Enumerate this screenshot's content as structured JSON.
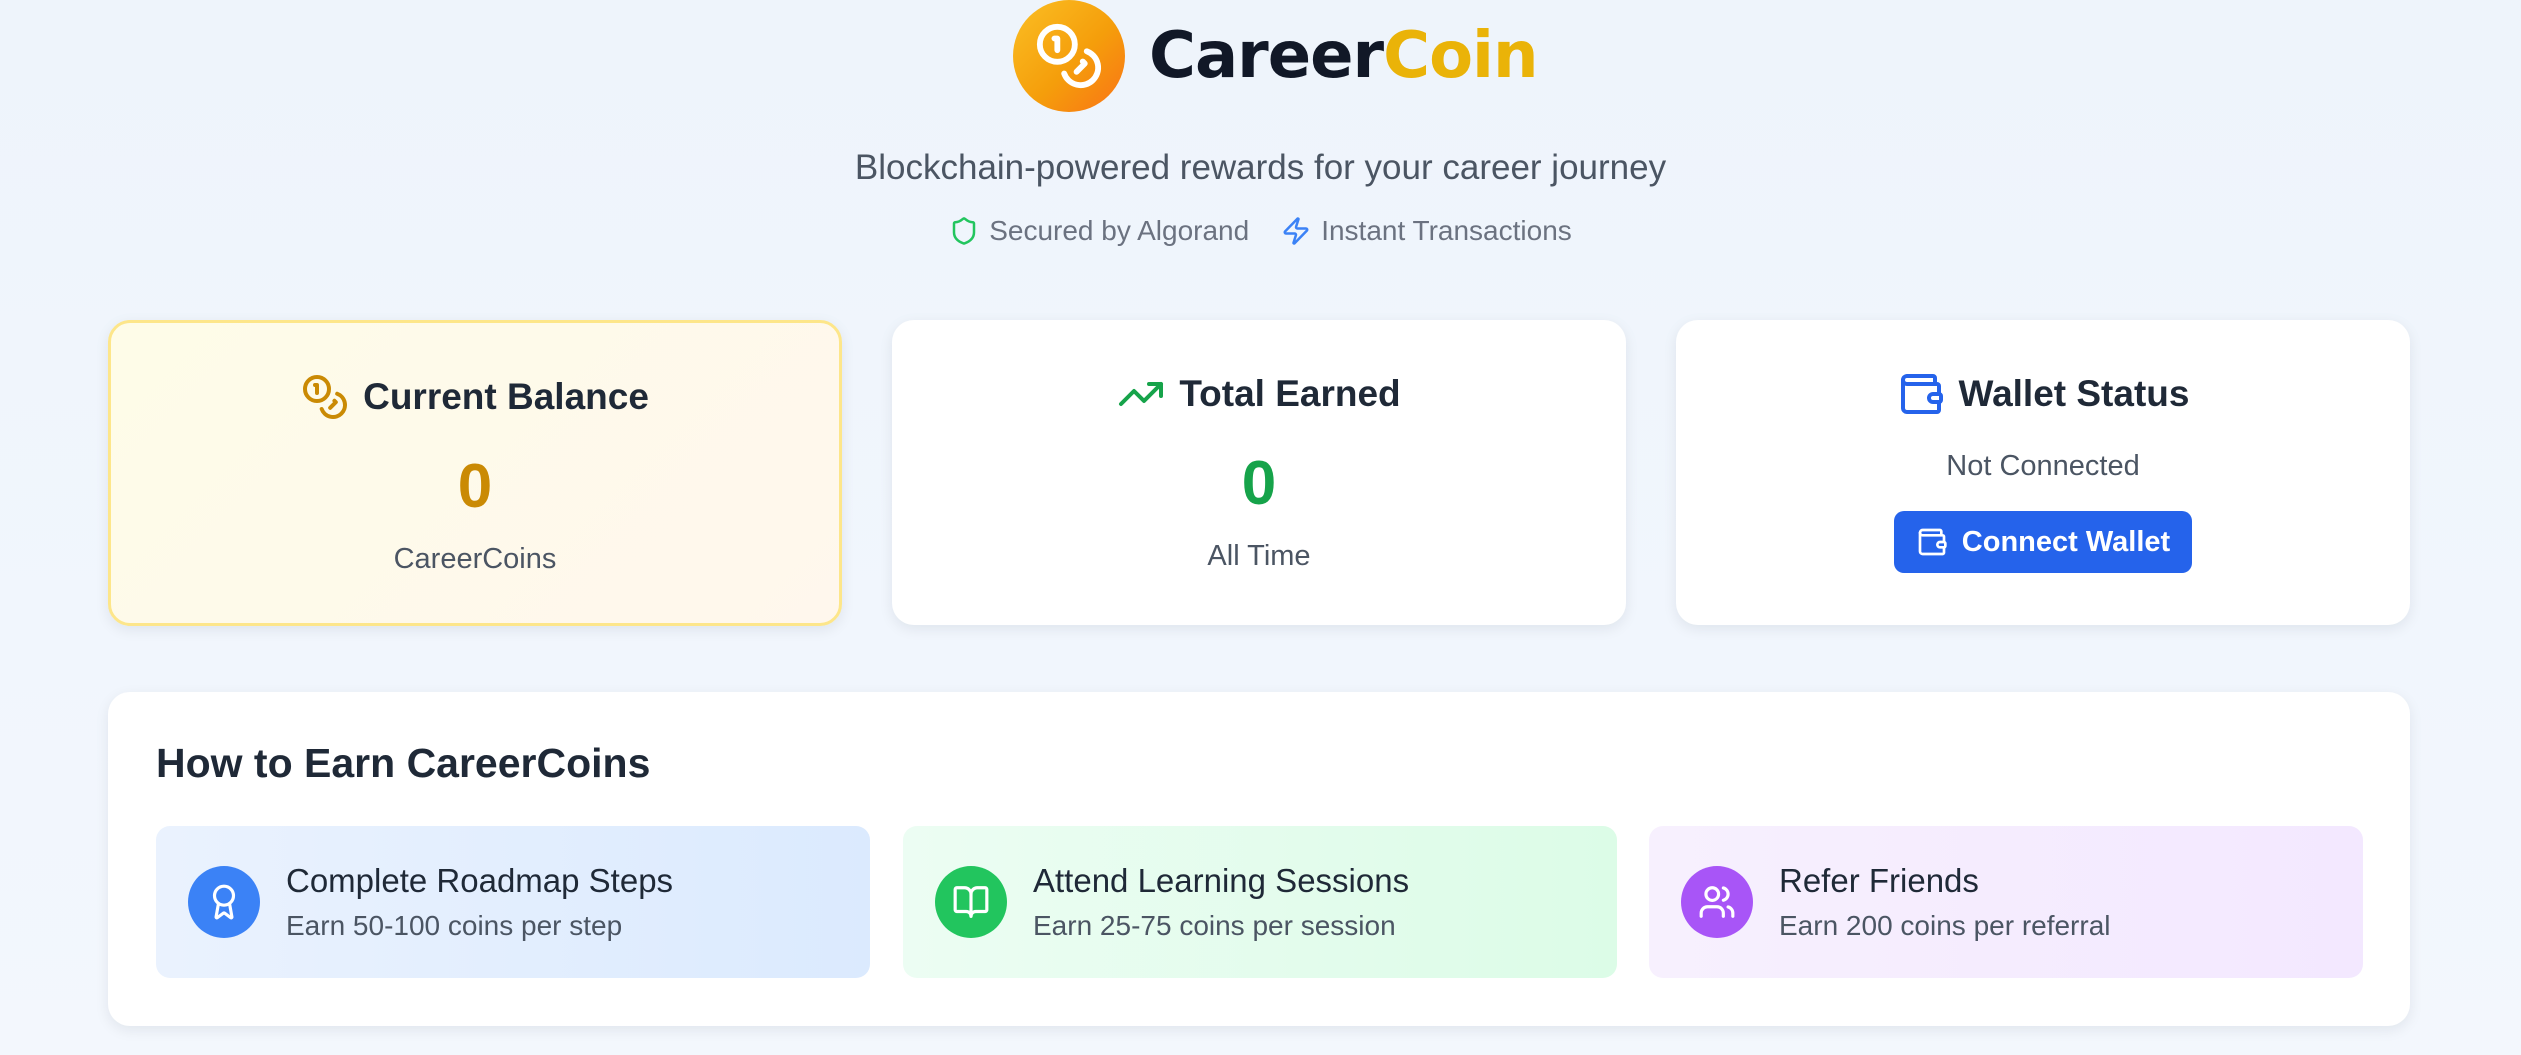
{
  "brand": {
    "name_part1": "Career",
    "name_part2": "Coin",
    "logo_icon": "coins-icon"
  },
  "tagline": "Blockchain-powered rewards for your career journey",
  "features": [
    {
      "icon": "shield-icon",
      "label": "Secured by Algorand",
      "color": "#22c55e"
    },
    {
      "icon": "lightning-icon",
      "label": "Instant Transactions",
      "color": "#3b82f6"
    }
  ],
  "cards": {
    "balance": {
      "icon": "coins-icon",
      "title": "Current Balance",
      "value": "0",
      "subtitle": "CareerCoins",
      "accent": "#ca8a04"
    },
    "earned": {
      "icon": "trending-up-icon",
      "title": "Total Earned",
      "value": "0",
      "subtitle": "All Time",
      "accent": "#16a34a"
    },
    "wallet": {
      "icon": "wallet-icon",
      "title": "Wallet Status",
      "status": "Not Connected",
      "button_label": "Connect Wallet",
      "accent": "#2563eb"
    }
  },
  "how_to_earn": {
    "title": "How to Earn CareerCoins",
    "items": [
      {
        "icon": "award-icon",
        "title": "Complete Roadmap Steps",
        "description": "Earn 50-100 coins per step",
        "color": "#3b82f6"
      },
      {
        "icon": "book-open-icon",
        "title": "Attend Learning Sessions",
        "description": "Earn 25-75 coins per session",
        "color": "#22c55e"
      },
      {
        "icon": "users-icon",
        "title": "Refer Friends",
        "description": "Earn 200 coins per referral",
        "color": "#a855f7"
      }
    ]
  }
}
